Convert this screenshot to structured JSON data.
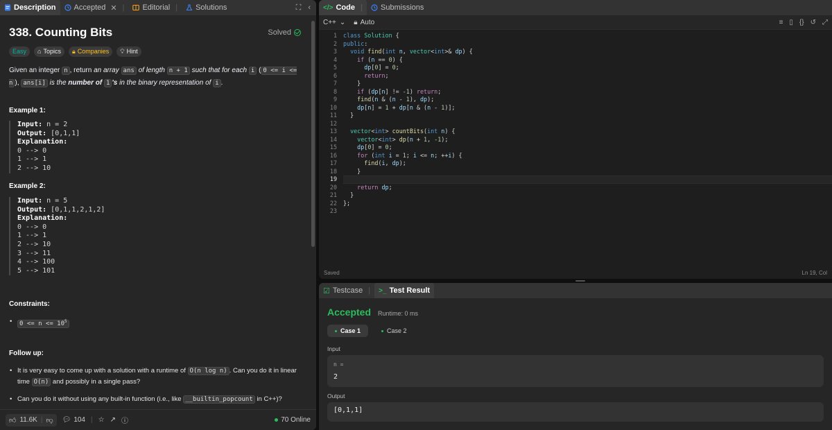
{
  "left_tabs": [
    {
      "label": "Description",
      "icon": "description-icon"
    },
    {
      "label": "Accepted",
      "icon": "history-icon"
    },
    {
      "label": "Editorial",
      "icon": "book-icon"
    },
    {
      "label": "Solutions",
      "icon": "flask-icon"
    }
  ],
  "problem": {
    "title": "338. Counting Bits",
    "status": "Solved",
    "tags": [
      "Easy",
      "Topics",
      "Companies",
      "Hint"
    ],
    "statement": {
      "p1": "Given an integer ",
      "c1": "n",
      "p2": ", return ",
      "i1": "an array ",
      "c2": "ans",
      "i2": " of length ",
      "c3": "n + 1",
      "i3": " such that for each ",
      "c4": "i",
      "p3": " (",
      "c5": "0 <= i <= n",
      "p4": "), ",
      "c6": "ans[i]",
      "i4": " is the ",
      "b1": "number of ",
      "c7": "1",
      "b2": "'s",
      "i5": " in the binary representation of ",
      "c8": "i",
      "p5": "."
    },
    "examples": [
      {
        "title": "Example 1:",
        "input_label": "Input:",
        "input": " n = 2",
        "output_label": "Output:",
        "output": " [0,1,1]",
        "expl_label": "Explanation:",
        "lines": [
          "0 --> 0",
          "1 --> 1",
          "2 --> 10"
        ]
      },
      {
        "title": "Example 2:",
        "input_label": "Input:",
        "input": " n = 5",
        "output_label": "Output:",
        "output": " [0,1,1,2,1,2]",
        "expl_label": "Explanation:",
        "lines": [
          "0 --> 0",
          "1 --> 1",
          "2 --> 10",
          "3 --> 11",
          "4 --> 100",
          "5 --> 101"
        ]
      }
    ],
    "constraints_title": "Constraints:",
    "constraint": "0 <= n <= 10",
    "constraint_sup": "5",
    "followup_title": "Follow up:",
    "followup1_a": "It is very easy to come up with a solution with a runtime of ",
    "followup1_code1": "O(n log n)",
    "followup1_b": ". Can you do it in linear time ",
    "followup1_code2": "O(n)",
    "followup1_c": " and possibly in a single pass?",
    "followup2_a": "Can you do it without using any built-in function (i.e., like ",
    "followup2_code": "__builtin_popcount",
    "followup2_b": " in C++)?"
  },
  "footer": {
    "likes": "11.6K",
    "comments": "104",
    "online": "70 Online"
  },
  "code_tabs": [
    {
      "label": "Code",
      "icon": "code-icon"
    },
    {
      "label": "Submissions",
      "icon": "history-icon"
    }
  ],
  "editor": {
    "language": "C++",
    "mode": "Auto",
    "status": "Saved",
    "cursor": "Ln 19, Col",
    "lines": [
      [
        [
          "kw",
          "class"
        ],
        [
          "",
          ""
        ],
        [
          "ty",
          " Solution"
        ],
        [
          "",
          "  {"
        ]
      ],
      [
        [
          "kw",
          "public"
        ],
        [
          "",
          ":"
        ]
      ],
      [
        [
          "",
          "    "
        ],
        [
          "kw",
          "void"
        ],
        [
          "",
          ""
        ],
        [
          "fn",
          " find"
        ],
        [
          "",
          "("
        ],
        [
          "kw",
          "int"
        ],
        [
          "vr",
          " n"
        ],
        [
          "",
          ", "
        ],
        [
          "ty",
          "vector"
        ],
        [
          "",
          "<"
        ],
        [
          "kw",
          "int"
        ],
        [
          "",
          ">& "
        ],
        [
          "vr",
          "dp"
        ],
        [
          "",
          ") {"
        ]
      ],
      [
        [
          "",
          "        "
        ],
        [
          "kc",
          "if"
        ],
        [
          "",
          ""
        ],
        [
          "",
          ""
        ],
        [
          "",
          ""
        ],
        [
          "",
          ""
        ],
        [
          "",
          ""
        ],
        [
          "",
          "  ("
        ],
        [
          "vr",
          "n"
        ],
        [
          "",
          "  == "
        ],
        [
          "nu",
          "0"
        ],
        [
          "",
          ") {"
        ]
      ],
      [
        [
          "",
          "            "
        ],
        [
          "vr",
          "dp"
        ],
        [
          "",
          "["
        ],
        [
          "nu",
          "0"
        ],
        [
          "",
          "] = "
        ],
        [
          "nu",
          "0"
        ],
        [
          "",
          ";"
        ]
      ],
      [
        [
          "",
          "            "
        ],
        [
          "kc",
          "return"
        ],
        [
          "",
          ";"
        ]
      ],
      [
        [
          "",
          "        }"
        ]
      ],
      [
        [
          "",
          "        "
        ],
        [
          "kc",
          "if"
        ],
        [
          "",
          "  ("
        ],
        [
          "vr",
          "dp"
        ],
        [
          "",
          "["
        ],
        [
          "vr",
          "n"
        ],
        [
          "",
          "] != "
        ],
        [
          "nu",
          "-1"
        ],
        [
          "",
          ") "
        ],
        [
          "kc",
          "return"
        ],
        [
          "",
          ";"
        ]
      ],
      [
        [
          "",
          "        "
        ],
        [
          "fn",
          "find"
        ],
        [
          "",
          "("
        ],
        [
          "vr",
          "n"
        ],
        [
          "",
          "  & ("
        ],
        [
          "vr",
          "n"
        ],
        [
          "",
          "  - "
        ],
        [
          "nu",
          "1"
        ],
        [
          "",
          "), "
        ],
        [
          "vr",
          "dp"
        ],
        [
          "",
          ");"
        ]
      ],
      [
        [
          "",
          "        "
        ],
        [
          "vr",
          "dp"
        ],
        [
          "",
          "["
        ],
        [
          "vr",
          "n"
        ],
        [
          "",
          "] = "
        ],
        [
          "nu",
          "1"
        ],
        [
          "",
          "  + "
        ],
        [
          "vr",
          "dp"
        ],
        [
          "",
          "["
        ],
        [
          "vr",
          "n"
        ],
        [
          "",
          "  & ("
        ],
        [
          "vr",
          "n"
        ],
        [
          "",
          "  - "
        ],
        [
          "nu",
          "1"
        ],
        [
          "",
          ")];"
        ]
      ],
      [
        [
          "",
          "    }"
        ]
      ],
      [
        [
          "",
          ""
        ]
      ],
      [
        [
          "",
          "    "
        ],
        [
          "ty",
          "vector"
        ],
        [
          "",
          "<"
        ],
        [
          "kw",
          "int"
        ],
        [
          "",
          "> "
        ],
        [
          "fn",
          "countBits"
        ],
        [
          "",
          "("
        ],
        [
          "kw",
          "int"
        ],
        [
          "vr",
          " n"
        ],
        [
          "",
          ") {"
        ]
      ],
      [
        [
          "",
          "        "
        ],
        [
          "ty",
          "vector"
        ],
        [
          "",
          "<"
        ],
        [
          "kw",
          "int"
        ],
        [
          "",
          "> "
        ],
        [
          "fn",
          "dp"
        ],
        [
          "",
          "("
        ],
        [
          "vr",
          "n"
        ],
        [
          "",
          "  + "
        ],
        [
          "nu",
          "1"
        ],
        [
          "",
          ", "
        ],
        [
          "nu",
          "-1"
        ],
        [
          "",
          ");"
        ]
      ],
      [
        [
          "",
          "        "
        ],
        [
          "vr",
          "dp"
        ],
        [
          "",
          "["
        ],
        [
          "nu",
          "0"
        ],
        [
          "",
          "] = "
        ],
        [
          "nu",
          "0"
        ],
        [
          "",
          ";"
        ]
      ],
      [
        [
          "",
          "        "
        ],
        [
          "kc",
          "for"
        ],
        [
          "",
          "  ("
        ],
        [
          "kw",
          "int"
        ],
        [
          "vr",
          " i"
        ],
        [
          "",
          "  = "
        ],
        [
          "nu",
          "1"
        ],
        [
          "",
          "; "
        ],
        [
          "vr",
          "i"
        ],
        [
          "",
          "  <= "
        ],
        [
          "vr",
          "n"
        ],
        [
          "",
          "; ++"
        ],
        [
          "vr",
          "i"
        ],
        [
          "",
          ") {"
        ]
      ],
      [
        [
          "",
          "            "
        ],
        [
          "fn",
          "find"
        ],
        [
          "",
          "("
        ],
        [
          "vr",
          "i"
        ],
        [
          "",
          ", "
        ],
        [
          "vr",
          "dp"
        ],
        [
          "",
          ");"
        ]
      ],
      [
        [
          "",
          "        }"
        ]
      ],
      [
        [
          "",
          ""
        ]
      ],
      [
        [
          "",
          "        "
        ],
        [
          "kc",
          "return"
        ],
        [
          "vr",
          " dp"
        ],
        [
          "",
          ";"
        ]
      ],
      [
        [
          "",
          "    }"
        ]
      ],
      [
        [
          "",
          "};"
        ]
      ],
      [
        [
          "",
          ""
        ]
      ]
    ],
    "current_line": 19
  },
  "result_tabs": [
    {
      "label": "Testcase",
      "icon": "checkbox-icon"
    },
    {
      "label": "Test Result",
      "icon": "terminal-icon"
    }
  ],
  "result": {
    "verdict": "Accepted",
    "runtime": "Runtime: 0 ms",
    "cases": [
      "Case 1",
      "Case 2"
    ],
    "input_label": "Input",
    "input_var": "n =",
    "input_value": "2",
    "output_label": "Output",
    "output_value": "[0,1,1]"
  },
  "colors": {
    "accepted": "#2cbb5d",
    "easy": "#00b8a3",
    "companies": "#ffc01e",
    "accent": "#3b82f6"
  }
}
